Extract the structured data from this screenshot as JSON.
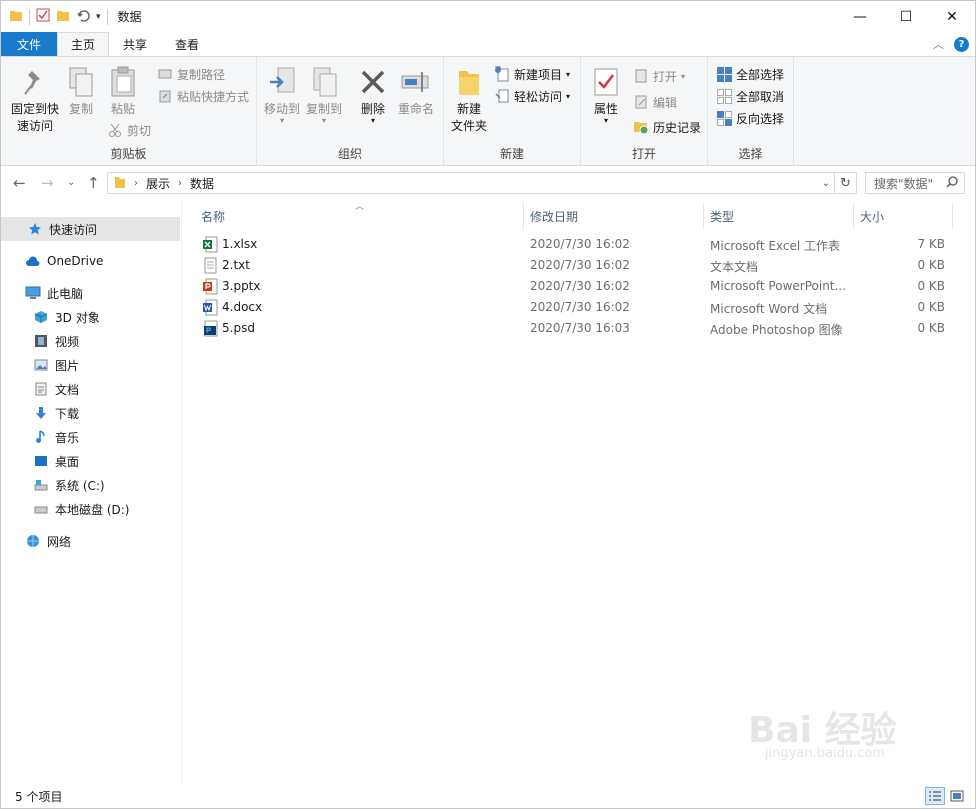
{
  "window": {
    "title": "数据",
    "controls": {
      "minimize": "—",
      "maximize": "☐",
      "close": "✕"
    }
  },
  "ribbon_tabs": {
    "file": "文件",
    "home": "主页",
    "share": "共享",
    "view": "查看"
  },
  "ribbon": {
    "clipboard": {
      "label": "剪贴板",
      "pin_line1": "固定到快",
      "pin_line2": "速访问",
      "copy": "复制",
      "paste": "粘贴",
      "copy_path": "复制路径",
      "paste_shortcut": "粘贴快捷方式",
      "cut": "剪切"
    },
    "organize": {
      "label": "组织",
      "move_to": "移动到",
      "copy_to": "复制到",
      "delete": "删除",
      "rename": "重命名"
    },
    "new": {
      "label": "新建",
      "new_folder_line1": "新建",
      "new_folder_line2": "文件夹",
      "new_item": "新建项目",
      "easy_access": "轻松访问"
    },
    "open": {
      "label": "打开",
      "properties": "属性",
      "open": "打开",
      "edit": "编辑",
      "history": "历史记录"
    },
    "select": {
      "label": "选择",
      "select_all": "全部选择",
      "select_none": "全部取消",
      "invert": "反向选择"
    }
  },
  "address": {
    "crumbs": [
      "展示",
      "数据"
    ],
    "search_placeholder": "搜索\"数据\""
  },
  "sidebar": {
    "quick_access": "快速访问",
    "onedrive": "OneDrive",
    "this_pc": "此电脑",
    "objects3d": "3D 对象",
    "videos": "视频",
    "pictures": "图片",
    "documents": "文档",
    "downloads": "下载",
    "music": "音乐",
    "desktop": "桌面",
    "drive_c": "系统 (C:)",
    "drive_d": "本地磁盘 (D:)",
    "network": "网络"
  },
  "columns": {
    "name": "名称",
    "date": "修改日期",
    "type": "类型",
    "size": "大小"
  },
  "files": [
    {
      "name": "1.xlsx",
      "date": "2020/7/30 16:02",
      "type": "Microsoft Excel 工作表",
      "size": "7 KB",
      "icon": "excel-icon",
      "color": "#1d7044"
    },
    {
      "name": "2.txt",
      "date": "2020/7/30 16:02",
      "type": "文本文档",
      "size": "0 KB",
      "icon": "text-file-icon",
      "color": "#808080"
    },
    {
      "name": "3.pptx",
      "date": "2020/7/30 16:02",
      "type": "Microsoft PowerPoint...",
      "size": "0 KB",
      "icon": "powerpoint-icon",
      "color": "#c43e1c"
    },
    {
      "name": "4.docx",
      "date": "2020/7/30 16:02",
      "type": "Microsoft Word 文档",
      "size": "0 KB",
      "icon": "word-icon",
      "color": "#2b579a"
    },
    {
      "name": "5.psd",
      "date": "2020/7/30 16:03",
      "type": "Adobe Photoshop 图像",
      "size": "0 KB",
      "icon": "photoshop-icon",
      "color": "#0f3a73"
    }
  ],
  "status": {
    "count": "5 个项目"
  },
  "watermark": {
    "line1": "Bai 经验",
    "line2": "jingyan.baidu.com"
  },
  "colors": {
    "accent": "#1979ca",
    "folder": "#f0c24b",
    "selected": "#e5e5e5"
  }
}
